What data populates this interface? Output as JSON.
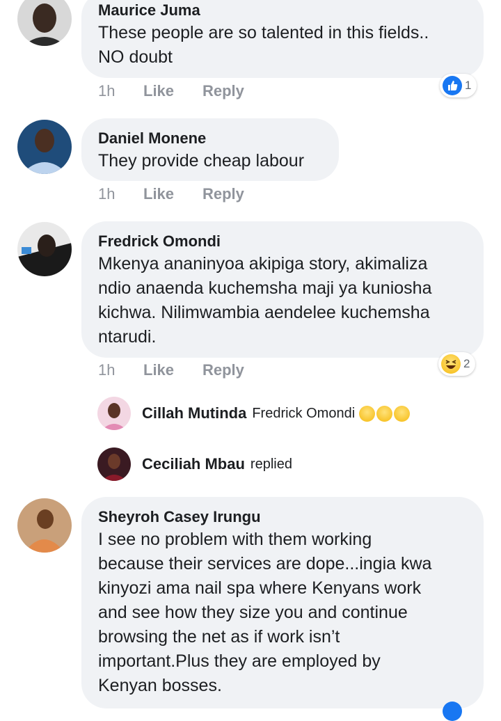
{
  "comments": [
    {
      "author": "Maurice Juma",
      "lines": [
        "These people are so talented in this fields..",
        "NO doubt"
      ],
      "time": "1h",
      "like_label": "Like",
      "reply_label": "Reply",
      "reaction": {
        "icon": "like-icon",
        "count": "1"
      }
    },
    {
      "author": "Daniel Monene",
      "lines": [
        "They provide cheap labour"
      ],
      "time": "1h",
      "like_label": "Like",
      "reply_label": "Reply"
    },
    {
      "author": "Fredrick Omondi",
      "lines": [
        "Mkenya ananinyoa  akipiga story, akimaliza",
        "ndio anaenda kuchemsha maji ya kuniosha",
        "kichwa. Nilimwambia aendelee kuchemsha",
        "ntarudi."
      ],
      "time": "1h",
      "like_label": "Like",
      "reply_label": "Reply",
      "reaction": {
        "icon": "haha-icon",
        "count": "2"
      },
      "replies": [
        {
          "author": "Cillah Mutinda",
          "text": "Fredrick Omondi",
          "emoji": "laughing-tears-icon"
        },
        {
          "author": "Ceciliah Mbau",
          "text": "replied"
        }
      ]
    },
    {
      "author": "Sheyroh Casey Irungu",
      "lines": [
        "I see no problem with them working",
        "because their services are dope...ingia kwa",
        "kinyozi ama nail spa where Kenyans work",
        "and see how they size you and continue",
        "browsing the net as if work isn’t",
        "important.Plus they are employed by",
        "Kenyan bosses."
      ]
    }
  ],
  "colors": {
    "bubble": "#f0f2f5",
    "meta": "#90949c",
    "like_blue": "#1877f2"
  }
}
